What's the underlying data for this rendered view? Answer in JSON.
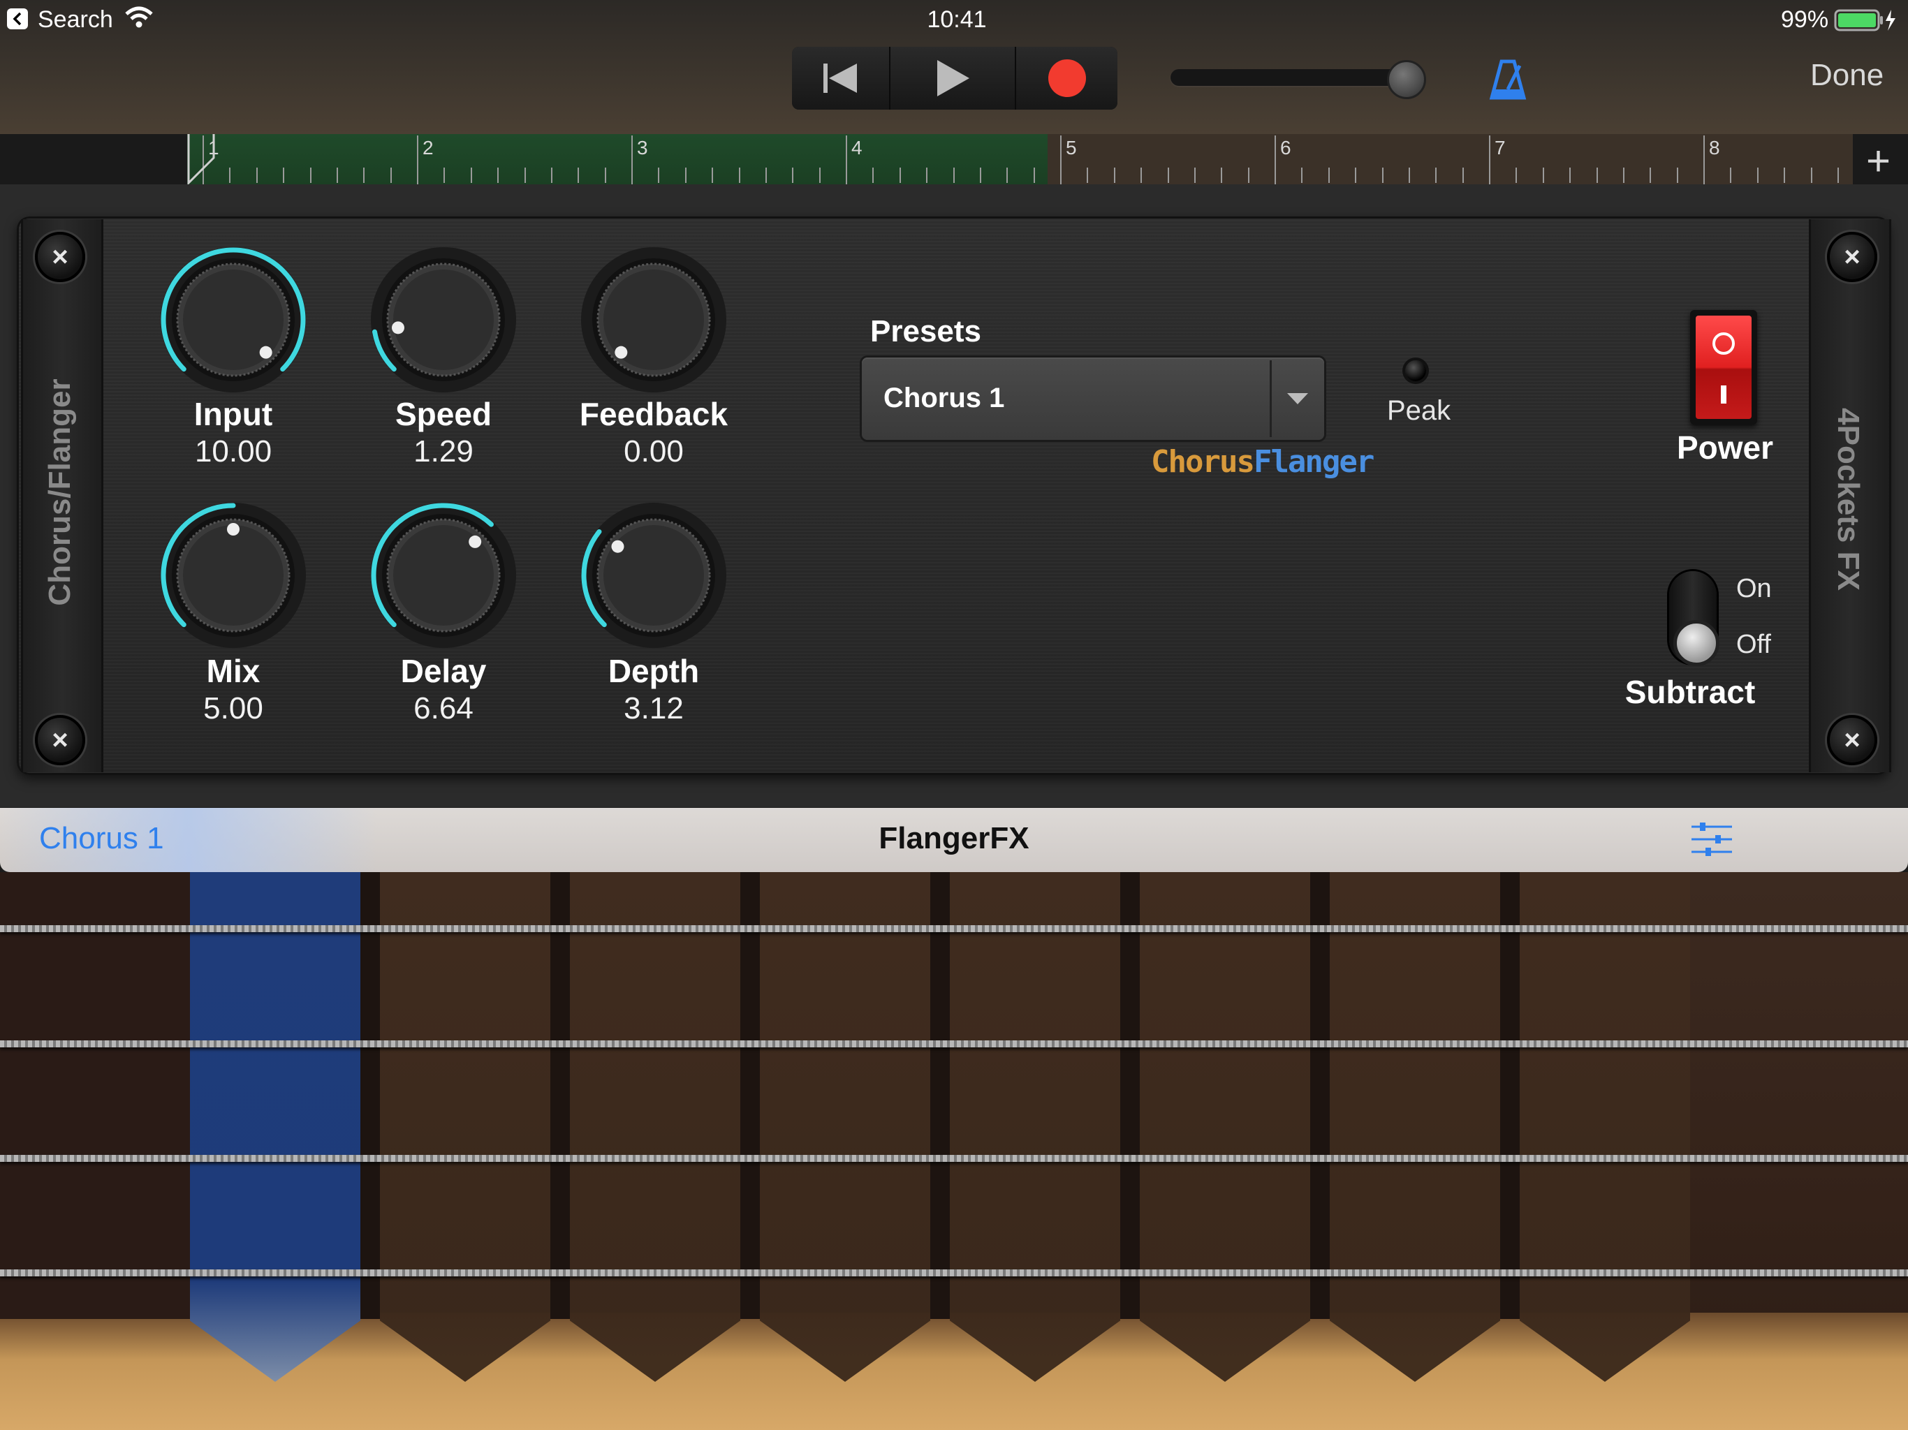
{
  "status_bar": {
    "back_app": "Search",
    "time": "10:41",
    "battery": "99%"
  },
  "transport": {
    "done_label": "Done",
    "volume_level": 0.93
  },
  "ruler": {
    "bars": [
      "1",
      "2",
      "3",
      "4",
      "5",
      "6",
      "7",
      "8"
    ],
    "add_symbol": "+"
  },
  "plugin": {
    "category_label": "Chorus/Flanger",
    "vendor_label": "4Pockets FX",
    "knobs": [
      {
        "label": "Input",
        "value": "10.00"
      },
      {
        "label": "Speed",
        "value": "1.29"
      },
      {
        "label": "Feedback",
        "value": "0.00"
      },
      {
        "label": "Mix",
        "value": "5.00"
      },
      {
        "label": "Delay",
        "value": "6.64"
      },
      {
        "label": "Depth",
        "value": "3.12"
      }
    ],
    "presets_title": "Presets",
    "preset_selected": "Chorus 1",
    "brand_part1": "Chorus",
    "brand_part2": "Flanger",
    "peak_label": "Peak",
    "power_label": "Power",
    "subtract_on": "On",
    "subtract_off": "Off",
    "subtract_label": "Subtract",
    "colors": {
      "accent": "#3fd8e0",
      "brand_chorus": "#d89a3c",
      "brand_flanger": "#4a8fe0",
      "power": "#e02020"
    }
  },
  "toolbar": {
    "preset_link": "Chorus 1",
    "title": "FlangerFX",
    "mixer_icon": "sliders-icon"
  }
}
